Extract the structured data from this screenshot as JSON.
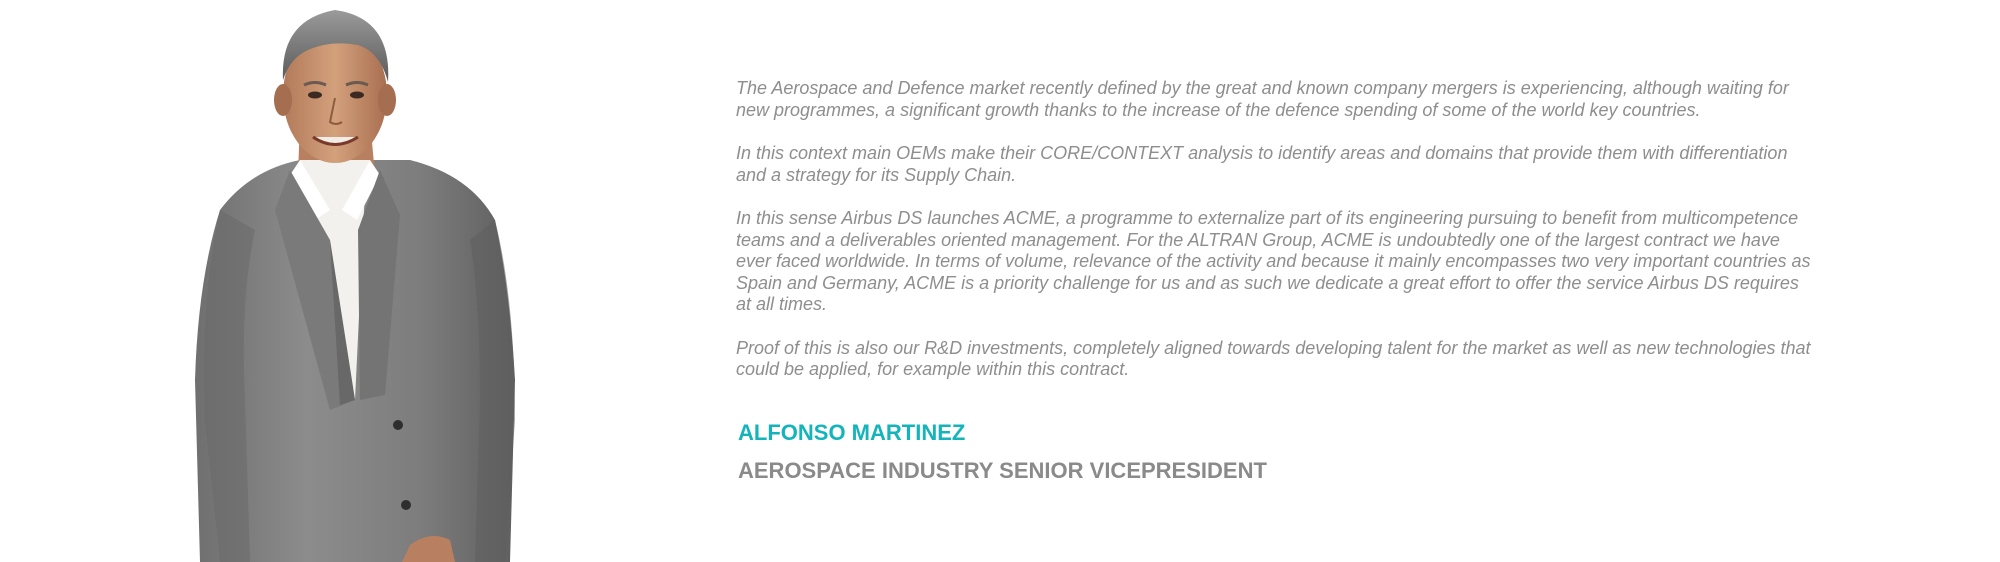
{
  "paragraphs": [
    "The Aerospace and Defence market recently defined by the great and known company mergers is experiencing, although waiting for new programmes, a significant growth thanks to the increase of the defence spending of some of the world key countries.",
    "In this context main OEMs make their CORE/CONTEXT analysis to identify areas and domains that provide them with differentiation and a strategy for its Supply Chain.",
    "In this sense Airbus DS launches ACME, a programme to externalize part of its engineering pursuing to benefit from multicompetence teams and a deliverables oriented management. For the ALTRAN Group, ACME is undoubtedly one of the largest contract  we have ever faced worldwide. In terms of volume, relevance of the activity and because it mainly encompasses two very important countries as Spain and Germany,  ACME is a priority challenge for us and as such we dedicate a great effort to offer the service Airbus DS requires at all times.",
    "Proof of this is also our R&D investments, completely aligned towards developing talent for the market as well as new technologies that could be applied, for example within this contract."
  ],
  "person": {
    "name": "ALFONSO MARTINEZ",
    "title": "AEROSPACE INDUSTRY SENIOR VICEPRESIDENT"
  },
  "colors": {
    "name_accent": "#14b4bb",
    "body_text": "#8e8e8e",
    "title_text": "#8a8a8a"
  }
}
